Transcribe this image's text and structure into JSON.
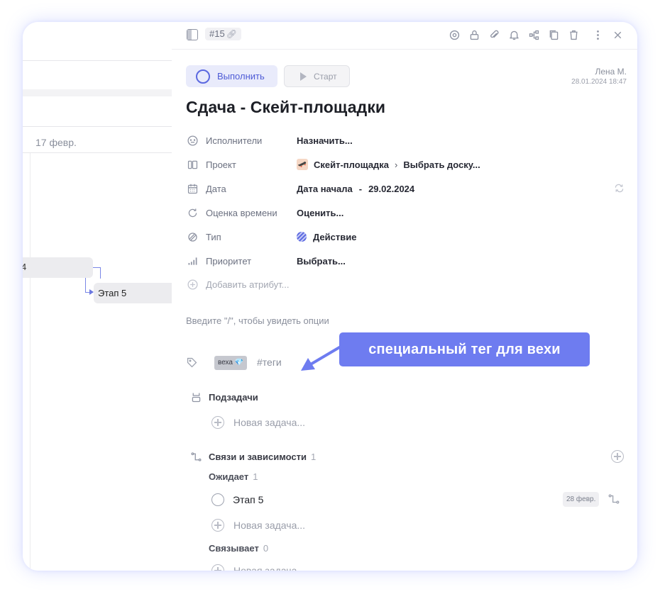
{
  "gantt": {
    "date_label": "17 февр.",
    "bar1_label": "4",
    "bar2_label": "Этап 5"
  },
  "toolbar": {
    "task_id": "#15",
    "icons": [
      "eye-icon",
      "lock-icon",
      "paperclip-icon",
      "bell-icon",
      "hierarchy-icon",
      "copy-icon",
      "trash-icon",
      "more-icon",
      "close-icon"
    ]
  },
  "actions": {
    "complete_label": "Выполнить",
    "start_label": "Старт"
  },
  "author": {
    "name": "Лена М.",
    "timestamp": "28.01.2024 18:47"
  },
  "task": {
    "title": "Сдача - Скейт-площадки"
  },
  "attributes": {
    "assignees": {
      "label": "Исполнители",
      "value": "Назначить..."
    },
    "project": {
      "label": "Проект",
      "value": "Скейт-площадка",
      "board": "Выбрать доску..."
    },
    "date": {
      "label": "Дата",
      "start": "Дата начала",
      "separator": "-",
      "end": "29.02.2024"
    },
    "estimate": {
      "label": "Оценка времени",
      "value": "Оценить..."
    },
    "type": {
      "label": "Тип",
      "value": "Действие"
    },
    "priority": {
      "label": "Приоритет",
      "value": "Выбрать..."
    },
    "add": {
      "label": "Добавить атрибут..."
    }
  },
  "editor": {
    "hint": "Введите \"/\", чтобы увидеть опции"
  },
  "tags": {
    "chip": "веха 💎",
    "placeholder": "#теги"
  },
  "callout": {
    "text": "специальный тег для вехи"
  },
  "subtasks": {
    "title": "Подзадачи",
    "new_task": "Новая задача..."
  },
  "dependencies": {
    "title": "Связи и зависимости",
    "count": "1",
    "waits": {
      "label": "Ожидает",
      "count": "1"
    },
    "item": {
      "title": "Этап 5",
      "date": "28 февр."
    },
    "new_task": "Новая задача...",
    "links": {
      "label": "Связывает",
      "count": "0"
    },
    "new_task_2": "Новая задача..."
  },
  "colors": {
    "accent": "#5b68e0",
    "callout": "#6e7cf0",
    "frame_glow": "#7887ff"
  }
}
